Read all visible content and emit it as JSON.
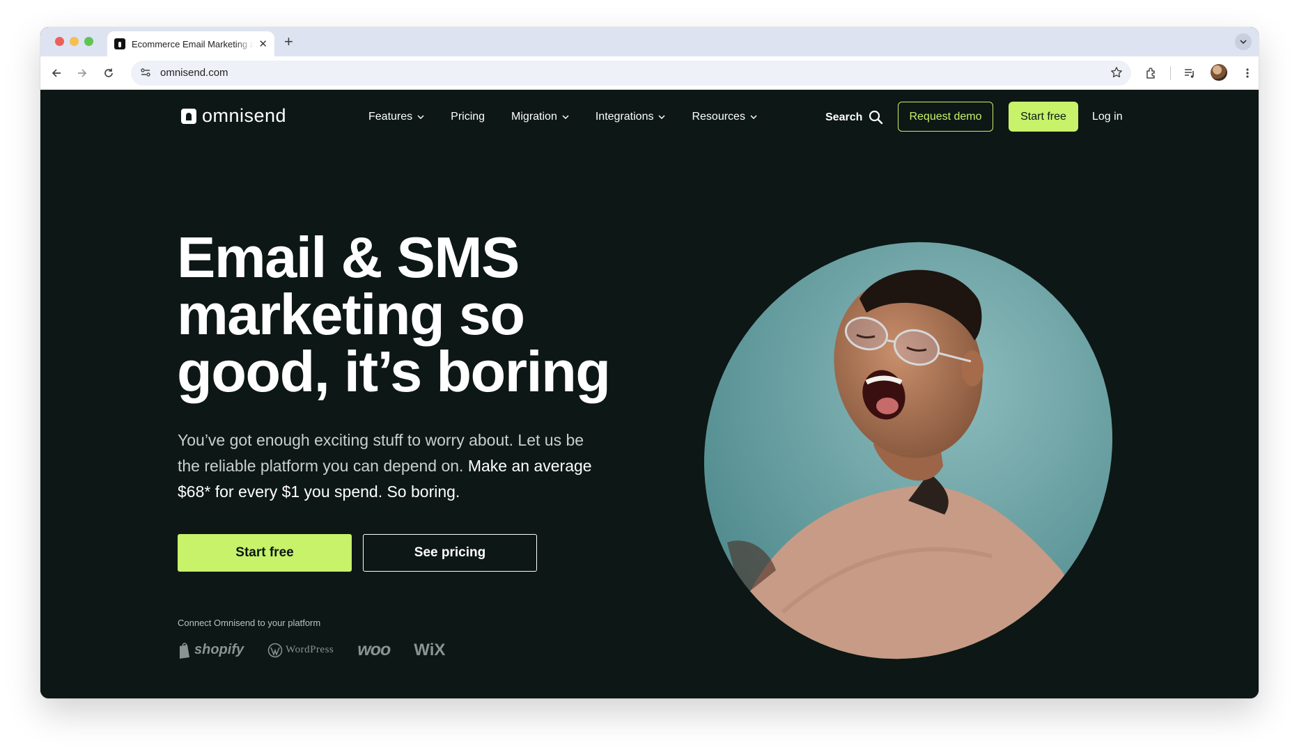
{
  "browser": {
    "tab_title": "Ecommerce Email Marketing and SMS",
    "url": "omnisend.com",
    "new_tab_symbol": "+",
    "close_symbol": "✕"
  },
  "nav": {
    "logo_text": "omnisend",
    "items": [
      {
        "label": "Features",
        "has_dropdown": true
      },
      {
        "label": "Pricing",
        "has_dropdown": false
      },
      {
        "label": "Migration",
        "has_dropdown": true
      },
      {
        "label": "Integrations",
        "has_dropdown": true
      },
      {
        "label": "Resources",
        "has_dropdown": true
      }
    ],
    "search_label": "Search",
    "request_demo": "Request demo",
    "start_free": "Start free",
    "log_in": "Log in"
  },
  "hero": {
    "title": "Email & SMS marketing so good, it’s boring",
    "subtitle_plain": "You’ve got enough exciting stuff to worry about. Let us be the reliable platform you can depend on. ",
    "subtitle_bold": "Make an average $68* for every $1 you spend. So boring.",
    "cta_primary": "Start free",
    "cta_secondary": "See pricing",
    "connect_label": "Connect Omnisend to your platform",
    "platforms": [
      "shopify",
      "WordPress",
      "woo",
      "WiX"
    ]
  },
  "colors": {
    "page_bg": "#0d1715",
    "accent": "#c7f26a",
    "photo_bg": "#6fa4a6",
    "sweater": "#c79b86"
  }
}
